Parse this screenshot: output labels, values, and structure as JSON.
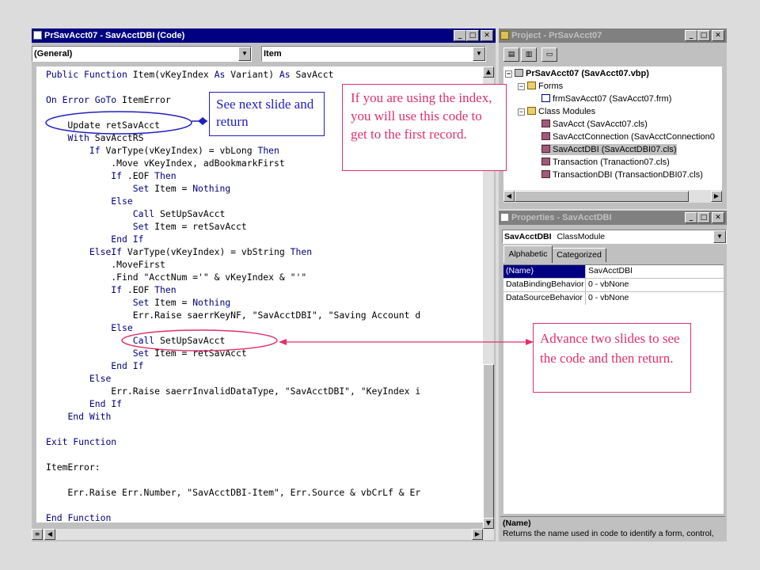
{
  "code_window": {
    "title": "PrSavAcct07 - SavAcctDBI (Code)",
    "object_combo": "(General)",
    "proc_combo": "Item",
    "lines": [
      "Public Function Item(vKeyIndex As Variant) As SavAcct",
      "",
      "On Error GoTo ItemError",
      "",
      "    Update retSavAcct",
      "    With SavAcctRS",
      "        If VarType(vKeyIndex) = vbLong Then",
      "            .Move vKeyIndex, adBookmarkFirst",
      "            If .EOF Then",
      "                Set Item = Nothing",
      "            Else",
      "                Call SetUpSavAcct",
      "                Set Item = retSavAcct",
      "            End If",
      "        ElseIf VarType(vKeyIndex) = vbString Then",
      "            .MoveFirst",
      "            .Find \"AcctNum ='\" & vKeyIndex & \"'\"",
      "            If .EOF Then",
      "                Set Item = Nothing",
      "                Err.Raise saerrKeyNF, \"SavAcctDBI\", \"Saving Account d",
      "            Else",
      "                Call SetUpSavAcct",
      "                Set Item = retSavAcct",
      "            End If",
      "        Else",
      "            Err.Raise saerrInvalidDataType, \"SavAcctDBI\", \"KeyIndex i",
      "        End If",
      "    End With",
      "",
      "Exit Function",
      "",
      "ItemError:",
      "",
      "    Err.Raise Err.Number, \"SavAcctDBI-Item\", Err.Source & vbCrLf & Er",
      "",
      "End Function"
    ]
  },
  "project_window": {
    "title": "Project - PrSavAcct07",
    "root": "PrSavAcct07 (SavAcct07.vbp)",
    "folders": [
      {
        "name": "Forms",
        "items": [
          "frmSavAcct07 (SavAcct07.frm)"
        ]
      },
      {
        "name": "Class Modules",
        "items": [
          "SavAcct (SavAcct07.cls)",
          "SavAcctConnection (SavAcctConnection0",
          "SavAcctDBI (SavAcctDBI07.cls)",
          "Transaction (Tranaction07.cls)",
          "TransactionDBI (TransactionDBI07.cls)"
        ]
      }
    ],
    "selected_item": "SavAcctDBI (SavAcctDBI07.cls)"
  },
  "properties_window": {
    "title": "Properties - SavAcctDBI",
    "object_combo_name": "SavAcctDBI",
    "object_combo_type": "ClassModule",
    "tabs": [
      "Alphabetic",
      "Categorized"
    ],
    "active_tab": "Alphabetic",
    "rows": [
      {
        "name": "(Name)",
        "value": "SavAcctDBI"
      },
      {
        "name": "DataBindingBehavior",
        "value": "0 - vbNone"
      },
      {
        "name": "DataSourceBehavior",
        "value": "0 - vbNone"
      }
    ],
    "description_title": "(Name)",
    "description_text": "Returns the name used in code to identify a form, control,"
  },
  "callouts": {
    "next_slide": "See next slide and return",
    "index_note": "If you are using the index, you will use this code to get to the first record.",
    "advance_note": "Advance two slides to see the code and then return."
  },
  "colors": {
    "title_active": "#000080",
    "title_inactive": "#808080",
    "keyword": "#00007f",
    "callout_pink": "#e0306a",
    "callout_navy": "#2020c0"
  }
}
